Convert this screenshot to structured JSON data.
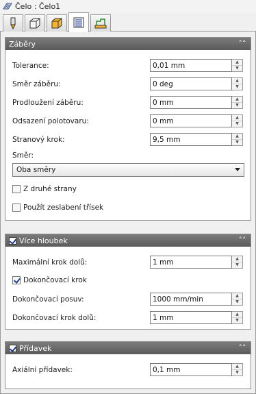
{
  "window": {
    "title": "Čelo : Čelo1"
  },
  "tabs": [
    {
      "icon": "tool-icon"
    },
    {
      "icon": "holder-icon"
    },
    {
      "icon": "stock-icon"
    },
    {
      "icon": "passes-icon",
      "active": true
    },
    {
      "icon": "linking-icon"
    }
  ],
  "zabery": {
    "title": "Záběry",
    "tolerance": {
      "label": "Tolerance:",
      "value": "0,01 mm"
    },
    "smer_zaberu": {
      "label": "Směr záběru:",
      "value": "0 deg"
    },
    "prodlouzeni": {
      "label": "Prodloužení záběru:",
      "value": "0 mm"
    },
    "odsazeni": {
      "label": "Odsazení polotovaru:",
      "value": "0 mm"
    },
    "stranovy_krok": {
      "label": "Stranový krok:",
      "value": "9,5 mm"
    },
    "smer": {
      "label": "Směr:",
      "selected": "Oba směry"
    },
    "z_druhe_strany": {
      "label": "Z druhé strany",
      "checked": false
    },
    "zeslabeni": {
      "label": "Použít zeslabení třísek",
      "checked": false
    }
  },
  "vice_hloubek": {
    "title": "Více hloubek",
    "enabled": true,
    "max_krok": {
      "label": "Maximální krok dolů:",
      "value": "1 mm"
    },
    "dokoncovaci_krok": {
      "label": "Dokončovací krok",
      "checked": true
    },
    "dokoncovaci_posuv": {
      "label": "Dokončovací posuv:",
      "value": "1000 mm/min"
    },
    "dokoncovaci_krok_dolu": {
      "label": "Dokončovací krok dolů:",
      "value": "1 mm"
    }
  },
  "pridavek": {
    "title": "Přídavek",
    "enabled": true,
    "axialni": {
      "label": "Axiální přídavek:",
      "value": "0,1 mm"
    }
  }
}
